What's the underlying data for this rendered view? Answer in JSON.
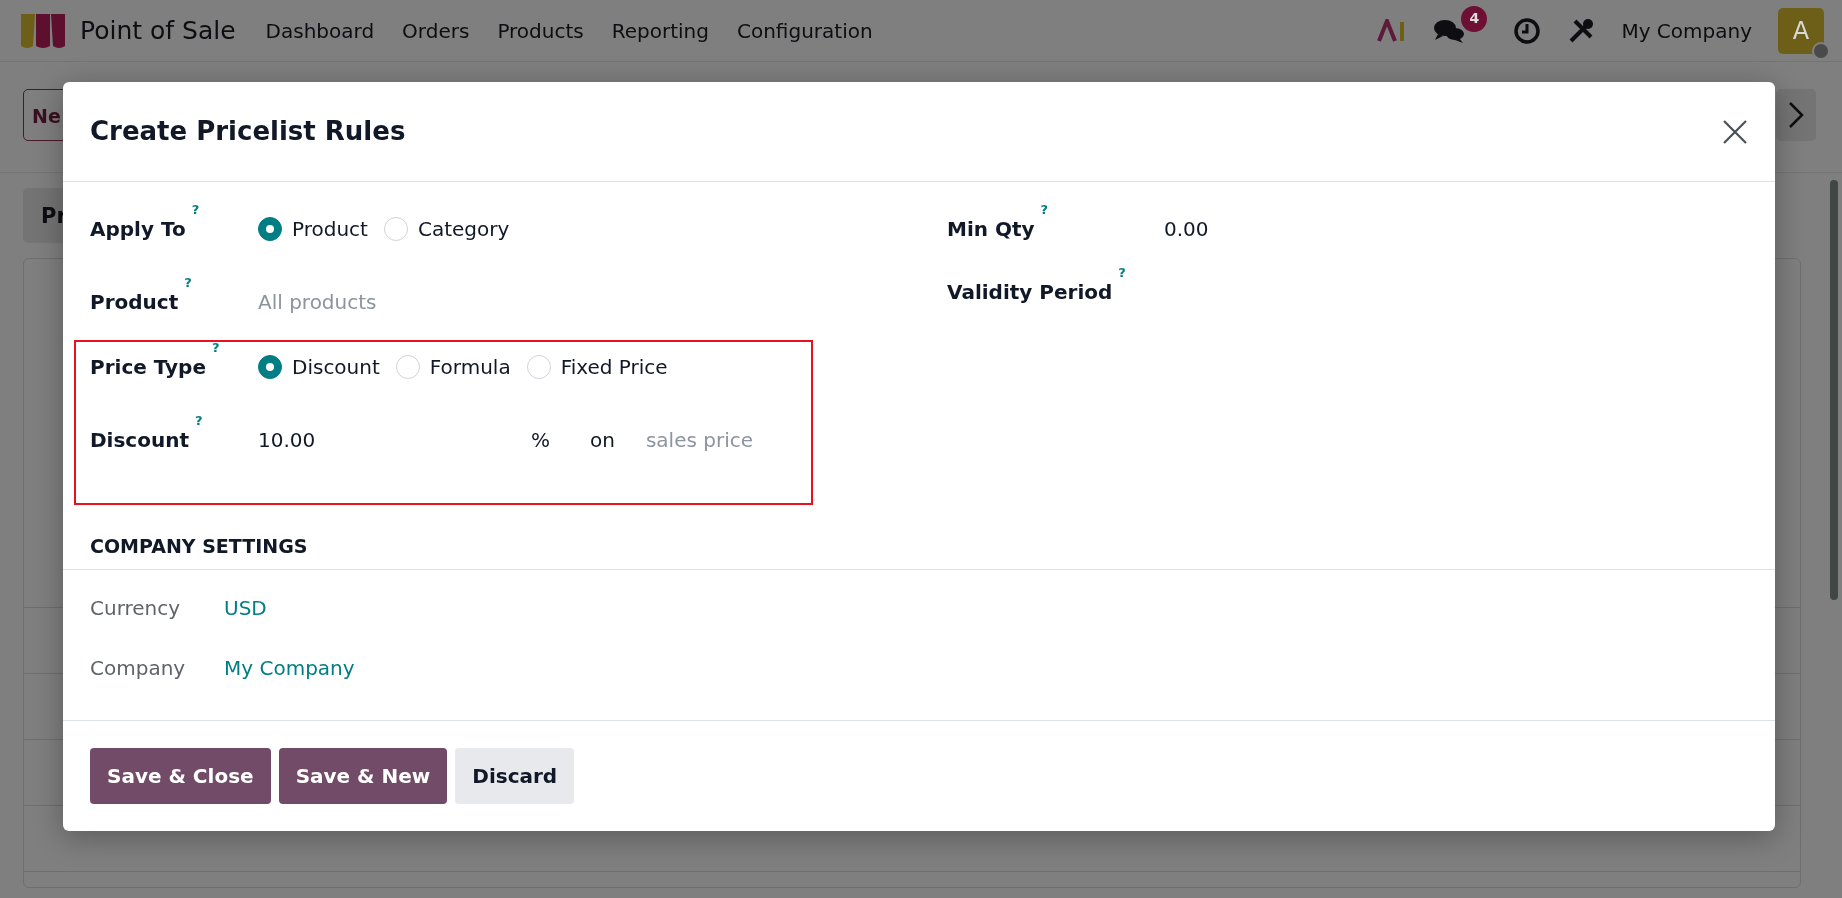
{
  "navbar": {
    "app_name": "Point of Sale",
    "menu": [
      "Dashboard",
      "Orders",
      "Products",
      "Reporting",
      "Configuration"
    ],
    "messages_badge": "4",
    "company": "My Company",
    "avatar_letter": "A"
  },
  "background": {
    "new_button": "Ne",
    "tab": "Pr"
  },
  "dialog": {
    "title": "Create Pricelist Rules",
    "fields_left": [
      {
        "kind": "radio",
        "label": "Apply To",
        "help": "?",
        "highlighted": false,
        "options": [
          {
            "label": "Product",
            "selected": true
          },
          {
            "label": "Category",
            "selected": false
          }
        ]
      },
      {
        "kind": "text",
        "label": "Product",
        "help": "?",
        "highlighted": false,
        "placeholder": "All products"
      },
      {
        "kind": "radio",
        "label": "Price Type",
        "help": "?",
        "highlighted": true,
        "options": [
          {
            "label": "Discount",
            "selected": true
          },
          {
            "label": "Formula",
            "selected": false
          },
          {
            "label": "Fixed Price",
            "selected": false
          }
        ]
      },
      {
        "kind": "discount",
        "label": "Discount",
        "help": "?",
        "highlighted": true,
        "value": "10.00",
        "unit": "%",
        "connector": "on",
        "placeholder": "sales price"
      }
    ],
    "fields_right": [
      {
        "kind": "text",
        "label": "Min Qty",
        "help": "?",
        "value": "0.00"
      },
      {
        "kind": "text",
        "label": "Validity Period",
        "help": "?"
      }
    ],
    "section_title": "COMPANY SETTINGS",
    "company_fields": [
      {
        "label": "Currency",
        "value": "USD"
      },
      {
        "label": "Company",
        "value": "My Company"
      }
    ],
    "buttons": [
      {
        "label": "Save & Close",
        "kind": "primary"
      },
      {
        "label": "Save & New",
        "kind": "primary"
      },
      {
        "label": "Discard",
        "kind": "secondary"
      }
    ]
  }
}
